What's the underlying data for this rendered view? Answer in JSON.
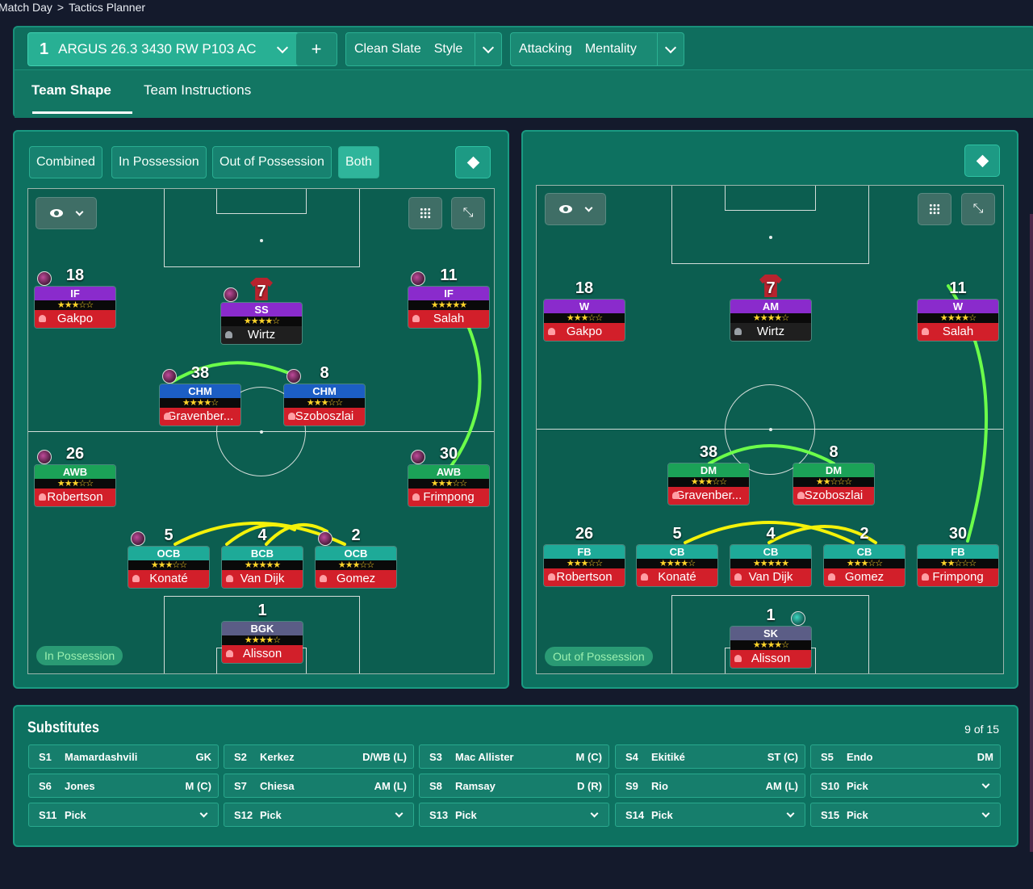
{
  "breadcrumb": {
    "root": "Match Day",
    "separator": ">",
    "current": "Tactics Planner"
  },
  "header": {
    "tactic_slot": "1",
    "tactic_name": "ARGUS 26.3 3430 RW P103 AC",
    "add_label": "+",
    "style_value": "Clean Slate",
    "style_label": "Style",
    "mentality_value": "Attacking",
    "mentality_label": "Mentality",
    "tabs": [
      {
        "label": "Team Shape"
      },
      {
        "label": "Team Instructions"
      }
    ]
  },
  "left_panel": {
    "toggles": [
      {
        "label": "Combined"
      },
      {
        "label": "In Possession"
      },
      {
        "label": "Out of Possession"
      },
      {
        "label": "Both"
      }
    ],
    "phase_label": "In Possession",
    "players": [
      {
        "number": "18",
        "role": "IF",
        "stars": "★★★☆☆",
        "name": "Gakpo"
      },
      {
        "number": "7",
        "role": "SS",
        "stars": "★★★★☆",
        "name": "Wirtz"
      },
      {
        "number": "11",
        "role": "IF",
        "stars": "★★★★★",
        "name": "Salah"
      },
      {
        "number": "38",
        "role": "CHM",
        "stars": "★★★★☆",
        "name": "Gravenber..."
      },
      {
        "number": "8",
        "role": "CHM",
        "stars": "★★★☆☆",
        "name": "Szoboszlai"
      },
      {
        "number": "26",
        "role": "AWB",
        "stars": "★★★☆☆",
        "name": "Robertson"
      },
      {
        "number": "30",
        "role": "AWB",
        "stars": "★★★☆☆",
        "name": "Frimpong"
      },
      {
        "number": "5",
        "role": "OCB",
        "stars": "★★★☆☆",
        "name": "Konaté"
      },
      {
        "number": "4",
        "role": "BCB",
        "stars": "★★★★★",
        "name": "Van Dijk"
      },
      {
        "number": "2",
        "role": "OCB",
        "stars": "★★★☆☆",
        "name": "Gomez"
      },
      {
        "number": "1",
        "role": "BGK",
        "stars": "★★★★☆",
        "name": "Alisson"
      }
    ]
  },
  "right_panel": {
    "phase_label": "Out of Possession",
    "players": [
      {
        "number": "18",
        "role": "W",
        "stars": "★★★☆☆",
        "name": "Gakpo"
      },
      {
        "number": "7",
        "role": "AM",
        "stars": "★★★★☆",
        "name": "Wirtz"
      },
      {
        "number": "11",
        "role": "W",
        "stars": "★★★★☆",
        "name": "Salah"
      },
      {
        "number": "38",
        "role": "DM",
        "stars": "★★★☆☆",
        "name": "Gravenber..."
      },
      {
        "number": "8",
        "role": "DM",
        "stars": "★★☆☆☆",
        "name": "Szoboszlai"
      },
      {
        "number": "26",
        "role": "FB",
        "stars": "★★★☆☆",
        "name": "Robertson"
      },
      {
        "number": "5",
        "role": "CB",
        "stars": "★★★★☆",
        "name": "Konaté"
      },
      {
        "number": "4",
        "role": "CB",
        "stars": "★★★★★",
        "name": "Van Dijk"
      },
      {
        "number": "2",
        "role": "CB",
        "stars": "★★★☆☆",
        "name": "Gomez"
      },
      {
        "number": "30",
        "role": "FB",
        "stars": "★★☆☆☆",
        "name": "Frimpong"
      },
      {
        "number": "1",
        "role": "SK",
        "stars": "★★★★☆",
        "name": "Alisson"
      }
    ]
  },
  "substitutes": {
    "title": "Substitutes",
    "count": "9 of 15",
    "slots": [
      {
        "slot": "S1",
        "name": "Mamardashvili",
        "pos": "GK"
      },
      {
        "slot": "S2",
        "name": "Kerkez",
        "pos": "D/WB (L)"
      },
      {
        "slot": "S3",
        "name": "Mac Allister",
        "pos": "M (C)"
      },
      {
        "slot": "S4",
        "name": "Ekitiké",
        "pos": "ST (C)"
      },
      {
        "slot": "S5",
        "name": "Endo",
        "pos": "DM"
      },
      {
        "slot": "S6",
        "name": "Jones",
        "pos": "M (C)"
      },
      {
        "slot": "S7",
        "name": "Chiesa",
        "pos": "AM (L)"
      },
      {
        "slot": "S8",
        "name": "Ramsay",
        "pos": "D (R)"
      },
      {
        "slot": "S9",
        "name": "Rio",
        "pos": "AM (L)"
      },
      {
        "slot": "S10",
        "name": "Pick",
        "pos": ""
      },
      {
        "slot": "S11",
        "name": "Pick",
        "pos": ""
      },
      {
        "slot": "S12",
        "name": "Pick",
        "pos": ""
      },
      {
        "slot": "S13",
        "name": "Pick",
        "pos": ""
      },
      {
        "slot": "S14",
        "name": "Pick",
        "pos": ""
      },
      {
        "slot": "S15",
        "name": "Pick",
        "pos": ""
      }
    ]
  },
  "colors": {
    "background": "#141a2c",
    "panel": "#0d7160",
    "link_green": "#6cff4a",
    "link_yellow": "#f4f20a",
    "card_red": "#d21f2a"
  }
}
